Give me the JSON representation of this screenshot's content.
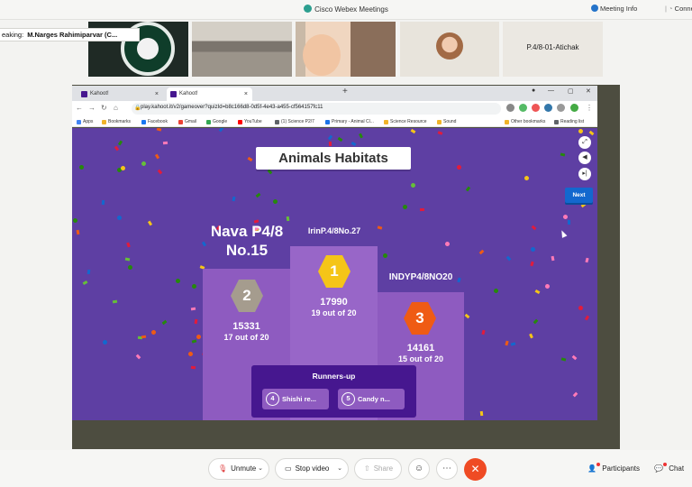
{
  "window": {
    "app_title": "Cisco Webex Meetings",
    "meeting_info": "Meeting Info",
    "connection": "Connec"
  },
  "speaking": {
    "prefix": "eaking:",
    "name": "M.Narges Rahimiparvar (C..."
  },
  "participants": [
    {
      "name": "",
      "type": "video"
    },
    {
      "name": "",
      "type": "video"
    },
    {
      "name": "",
      "type": "video"
    },
    {
      "name": "",
      "type": "avatar"
    },
    {
      "name": "P.4/8-01-Atichak",
      "type": "name-only"
    }
  ],
  "browser": {
    "tabs": [
      {
        "label": "Kahoot!",
        "active": false
      },
      {
        "label": "Kahoot!",
        "active": true
      }
    ],
    "url": "play.kahoot.it/v2/gameover?quizId=b8c166d8-0d5f-4e43-a455-cf564157fc11",
    "bookmarks": [
      {
        "label": "Apps",
        "color": "#4285f4"
      },
      {
        "label": "Bookmarks",
        "color": "#f0b429"
      },
      {
        "label": "Facebook",
        "color": "#1877f2"
      },
      {
        "label": "Gmail",
        "color": "#ea4335"
      },
      {
        "label": "Google",
        "color": "#34a853"
      },
      {
        "label": "YouTube",
        "color": "#ff0000"
      },
      {
        "label": "(1) Science P2/7",
        "color": "#5f6368"
      },
      {
        "label": "Primary - Animal Cl...",
        "color": "#1a73e8"
      },
      {
        "label": "Science Resource",
        "color": "#f0b429"
      },
      {
        "label": "Sound",
        "color": "#f0b429"
      },
      {
        "label": "Other bookmarks",
        "color": "#f0b429"
      },
      {
        "label": "Reading list",
        "color": "#5f6368"
      }
    ]
  },
  "kahoot": {
    "quiz_title": "Animals Habitats",
    "next_label": "Next",
    "podium": [
      {
        "place": "1",
        "name": "IrinP.4/8No.27",
        "score": "17990",
        "correct": "19 out of 20",
        "color": "#f5c518"
      },
      {
        "place": "2",
        "name_line1": "Nava P4/8",
        "name_line2": "No.15",
        "score": "15331",
        "correct": "17 out of 20",
        "color": "#a59c8e"
      },
      {
        "place": "3",
        "name": "INDYP4/8NO20",
        "score": "14161",
        "correct": "15 out of 20",
        "color": "#ef5b14"
      }
    ],
    "runners_up": {
      "heading": "Runners-up",
      "items": [
        {
          "place": "4",
          "name": "Shishi re..."
        },
        {
          "place": "5",
          "name": "Candy n..."
        }
      ]
    }
  },
  "toolbar": {
    "unmute": "Unmute",
    "stop_video": "Stop video",
    "share": "Share",
    "participants": "Participants",
    "chat": "Chat"
  }
}
